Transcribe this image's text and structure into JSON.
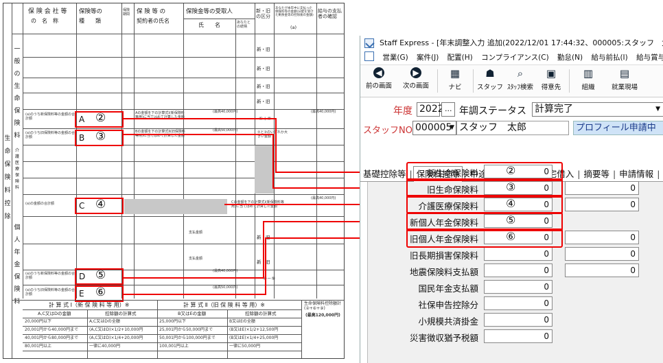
{
  "form": {
    "col_company": "保 険 会 社 等",
    "col_company2": "の　名　称",
    "col_type": "保険等の",
    "col_type2": "種　　類",
    "col_period": "保険期間",
    "col_holder": "保 険 等 の",
    "col_holder2": "契約者の氏名",
    "col_recipient": "保険金等の受取人",
    "col_recipient_name": "氏　　名",
    "col_relation": "あなたとの続柄",
    "col_kubun": "新・旧の区分",
    "col_amount_note": "あなたが本年中に支払った保険料等の金額(分配を受けた剰余金等の控除後の金額)",
    "col_payer": "給与の支払者の確認",
    "col_a": "(a)",
    "sec_life": "一般の生命保険料",
    "sec_care": "介護医療保険料",
    "sec_pension": "個人年金保険料",
    "sec_outer": "生命保険料控除",
    "new_old": "新・旧",
    "yen": "円",
    "row_a_label": "(a)のうち新保険料等の金額の合計額",
    "row_b_label": "(a)のうち旧保険料等の金額の合計額",
    "row_c_label": "(a)の金額の合計額",
    "row_d_label": "(a)のうち新保険料等の金額の合計額",
    "row_e_label": "(a)のうち旧保険料等の金額の合計額",
    "calc_note_1": "Aの金額を下の計算式Ⅰ(新保険料等用)に当てはめて計算した金額",
    "calc_note_2": "Bの金額を下の計算式Ⅱ(旧保険料等用)に当てはめて計算した金額",
    "calc_note_3": "Cの金額を下の計算式Ⅰ(新保険料等用)に当てはめて計算した金額",
    "limit_40000": "(最高40,000円)",
    "limit_50000": "(最高50,000円)",
    "sum_line": "①＋②",
    "sum_line2": "②と③のいずれか大きい金額",
    "sum_line3": "④－⑤",
    "pay_amount": "支払金額",
    "letter_a": "A",
    "letter_b": "B",
    "letter_c": "C",
    "letter_d": "D",
    "letter_e": "E",
    "mark_2": "②",
    "mark_3": "③",
    "mark_4": "④",
    "mark_5": "⑤",
    "mark_6": "⑥",
    "formula1_title": "計 算 式 Ⅰ（新 保 険 料 等 用）※",
    "formula2_title": "計 算 式 Ⅱ（旧 保 険 料 等 用）※",
    "formula_total": "生命保険料控除額計(②+⑥+⑨)",
    "formula_total_limit": "(最高120,000円)",
    "f1_col1": "A,C又はDの金額",
    "f1_col2": "控除額の計算式",
    "f2_col1": "B又はEの金額",
    "f2_col2": "控除額の計算式",
    "f1_rows": [
      [
        "20,000円以下",
        "A,C又はDの全額"
      ],
      [
        "20,001円から40,000円まで",
        "(A,C又はD)×1/2+10,000円"
      ],
      [
        "40,001円から80,000円まで",
        "(A,C又はD)×1/4+20,000円"
      ],
      [
        "80,001円以上",
        "一律に40,000円"
      ]
    ],
    "f2_rows": [
      [
        "25,000円以下",
        "B又はEの全額"
      ],
      [
        "25,001円から50,000円まで",
        "(B又はE)×1/2+12,500円"
      ],
      [
        "50,001円から100,000円まで",
        "(B又はE)×1/4+25,000円"
      ],
      [
        "100,001円以上",
        "一律に50,000円"
      ]
    ]
  },
  "app": {
    "window_title": "Staff Express - [年末調整入力 追加(2022/12/01 17:44:32、000005:スタッフ　太郎) 更新(2022",
    "menu": [
      "営業(G)",
      "案件(J)",
      "配置(H)",
      "コンプライアンス(C)",
      "勤怠(N)",
      "給与前払(I)",
      "給与賞与年調("
    ],
    "toolbar": [
      {
        "label": "前の画面",
        "icon": "arrow-left-icon"
      },
      {
        "label": "次の画面",
        "icon": "arrow-right-icon"
      },
      {
        "label": "ナビ",
        "icon": "navi-icon"
      },
      {
        "label": "スタッフ",
        "icon": "staff-icon"
      },
      {
        "label": "ｽﾀｯﾌ検索",
        "icon": "staff-search-icon"
      },
      {
        "label": "得意先",
        "icon": "client-icon"
      },
      {
        "label": "組織",
        "icon": "org-icon"
      },
      {
        "label": "就業現場",
        "icon": "workplace-icon"
      }
    ],
    "year_label": "年度",
    "year_value": "2022",
    "year_button": "...",
    "status_label": "年調ステータス",
    "status_value": "計算完了",
    "staff_no_label": "スタッフNO",
    "staff_no_value": "000005",
    "staff_name": "スタッフ　太郎",
    "profile_badge": "プロフィール申請中",
    "tabs": [
      "基礎控除等",
      "保険料控除",
      "中途・調整収入",
      "住宅借入",
      "摘要等",
      "申請情報"
    ],
    "active_tab": "保険料控除",
    "fields": [
      {
        "label": "新生命保険料",
        "value": "0",
        "mark": "②",
        "second": null
      },
      {
        "label": "旧生命保険料",
        "value": "0",
        "mark": "③",
        "second": "0"
      },
      {
        "label": "介護医療保険料",
        "value": "0",
        "mark": "④",
        "second": "0"
      },
      {
        "label": "新個人年金保険料",
        "value": "0",
        "mark": "⑤",
        "second": null
      },
      {
        "label": "旧個人年金保険料",
        "value": "0",
        "mark": "⑥",
        "second": "0"
      },
      {
        "label": "旧長期損害保険料",
        "value": "0",
        "mark": "",
        "second": "0"
      },
      {
        "label": "地震保険料支払額",
        "value": "0",
        "mark": "",
        "second": "0"
      },
      {
        "label": "国民年金支払額",
        "value": "0",
        "mark": "",
        "second": null
      },
      {
        "label": "社保申告控除分",
        "value": "0",
        "mark": "",
        "second": null
      },
      {
        "label": "小規模共済掛金",
        "value": "0",
        "mark": "",
        "second": null
      },
      {
        "label": "災害徴収猶予税額",
        "value": "0",
        "mark": "",
        "second": null
      }
    ]
  },
  "colors": {
    "highlight": "#e00000",
    "label_red": "#cc3333",
    "badge_bg": "#cfe3f7"
  }
}
